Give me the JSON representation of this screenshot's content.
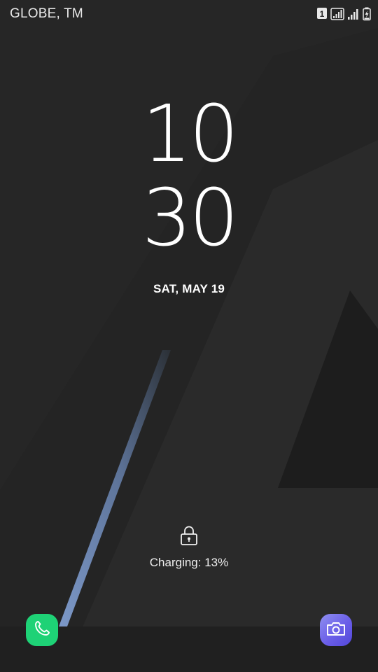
{
  "status_bar": {
    "carrier": "GLOBE, TM",
    "sim_badge": "1",
    "icons": [
      "sim-1-icon",
      "signal-icon",
      "signal-icon",
      "battery-charging-icon"
    ]
  },
  "clock": {
    "hour": "10",
    "minute": "30"
  },
  "date": "SAT, MAY 19",
  "lock": {
    "icon": "lock-icon",
    "charging_text": "Charging: 13%"
  },
  "shortcuts": {
    "left": {
      "icon": "phone-icon",
      "color": "#1ed276"
    },
    "right": {
      "icon": "camera-icon",
      "color": "#6a5ee8"
    }
  },
  "theme": {
    "background": "#262626",
    "accent_stripe": "#6f89b8",
    "text": "#ffffff"
  }
}
